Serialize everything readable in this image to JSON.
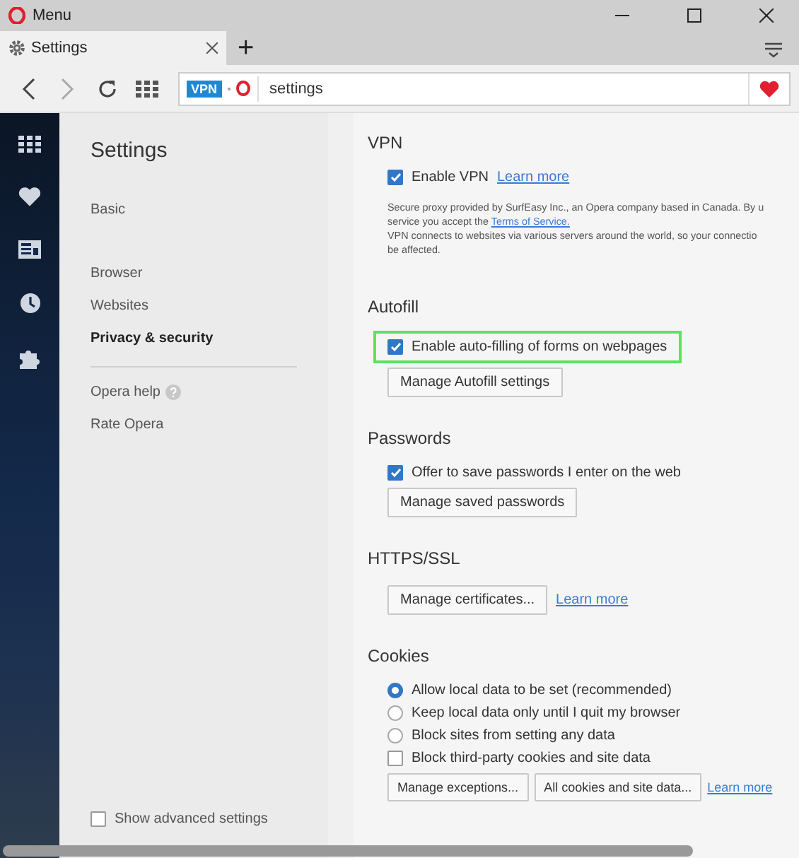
{
  "window": {
    "title": "Menu"
  },
  "tabs": [
    {
      "label": "Settings",
      "selected": true
    }
  ],
  "new_tab": "+",
  "address_bar": {
    "badge": "VPN",
    "value": "settings"
  },
  "settings_nav": {
    "title": "Settings",
    "groups": [
      [
        {
          "label": "Basic",
          "selected": false
        }
      ],
      [
        {
          "label": "Browser",
          "selected": false
        },
        {
          "label": "Websites",
          "selected": false
        },
        {
          "label": "Privacy & security",
          "selected": true
        }
      ]
    ],
    "secondary": [
      {
        "label": "Opera help",
        "help": true
      },
      {
        "label": "Rate Opera",
        "help": false
      }
    ],
    "advanced": {
      "label": "Show advanced settings",
      "checked": false
    }
  },
  "sections": [
    {
      "heading": "VPN",
      "items": [
        {
          "kind": "checkbox",
          "label": "Enable VPN",
          "checked": true,
          "link": "Learn more",
          "highlighted": false
        },
        {
          "kind": "note",
          "lines": [
            {
              "text": "Secure proxy provided by SurfEasy Inc., an Opera company based in Canada. By u"
            },
            {
              "text": "service you accept the ",
              "link": "Terms of Service."
            },
            {
              "text": "VPN connects to websites via various servers around the world, so your connectio"
            },
            {
              "text": "be affected."
            }
          ]
        }
      ]
    },
    {
      "heading": "Autofill",
      "items": [
        {
          "kind": "checkbox",
          "label": "Enable auto-filling of forms on webpages",
          "checked": true,
          "highlighted": true
        },
        {
          "kind": "buttons",
          "buttons": [
            "Manage Autofill settings"
          ]
        }
      ]
    },
    {
      "heading": "Passwords",
      "items": [
        {
          "kind": "checkbox",
          "label": "Offer to save passwords I enter on the web",
          "checked": true,
          "highlighted": false
        },
        {
          "kind": "buttons",
          "buttons": [
            "Manage saved passwords"
          ]
        }
      ]
    },
    {
      "heading": "HTTPS/SSL",
      "items": [
        {
          "kind": "buttons",
          "buttons": [
            "Manage certificates..."
          ],
          "link": "Learn more"
        }
      ]
    },
    {
      "heading": "Cookies",
      "items": [
        {
          "kind": "radio",
          "label": "Allow local data to be set (recommended)",
          "selected": true
        },
        {
          "kind": "radio",
          "label": "Keep local data only until I quit my browser",
          "selected": false
        },
        {
          "kind": "radio",
          "label": "Block sites from setting any data",
          "selected": false
        },
        {
          "kind": "checkbox",
          "label": "Block third-party cookies and site data",
          "checked": false,
          "highlighted": false
        },
        {
          "kind": "buttons",
          "buttons": [
            "Manage exceptions...",
            "All cookies and site data..."
          ],
          "link": "Learn more"
        }
      ]
    }
  ]
}
